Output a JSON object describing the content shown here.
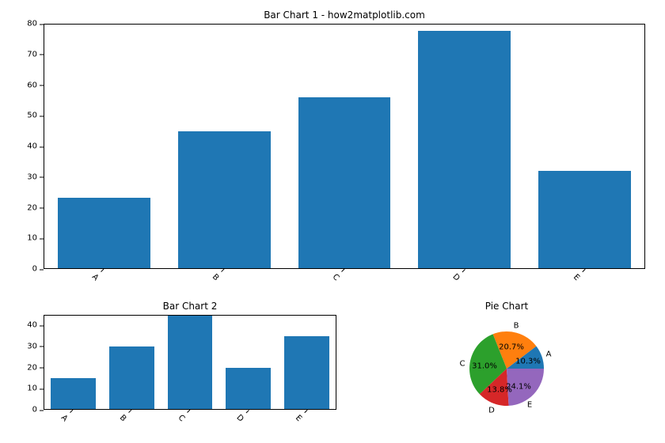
{
  "chart_data": [
    {
      "type": "bar",
      "title": "Bar Chart 1 - how2matplotlib.com",
      "categories": [
        "A",
        "B",
        "C",
        "D",
        "E"
      ],
      "values": [
        23,
        45,
        56,
        78,
        32
      ],
      "ylim": [
        0,
        80
      ],
      "yticks": [
        0,
        10,
        20,
        30,
        40,
        50,
        60,
        70,
        80
      ],
      "color": "#1f77b4"
    },
    {
      "type": "bar",
      "title": "Bar Chart 2",
      "categories": [
        "A",
        "B",
        "C",
        "D",
        "E"
      ],
      "values": [
        15,
        30,
        45,
        20,
        35
      ],
      "ylim": [
        0,
        45
      ],
      "yticks": [
        0,
        10,
        20,
        30,
        40
      ],
      "color": "#1f77b4"
    },
    {
      "type": "pie",
      "title": "Pie Chart",
      "labels": [
        "A",
        "B",
        "C",
        "D",
        "E"
      ],
      "values": [
        15,
        30,
        45,
        20,
        35
      ],
      "percentages": [
        "10.3%",
        "20.7%",
        "31.0%",
        "13.8%",
        "24.1%"
      ],
      "colors": [
        "#1f77b4",
        "#ff7f0e",
        "#2ca02c",
        "#d62728",
        "#9467bd"
      ]
    }
  ]
}
